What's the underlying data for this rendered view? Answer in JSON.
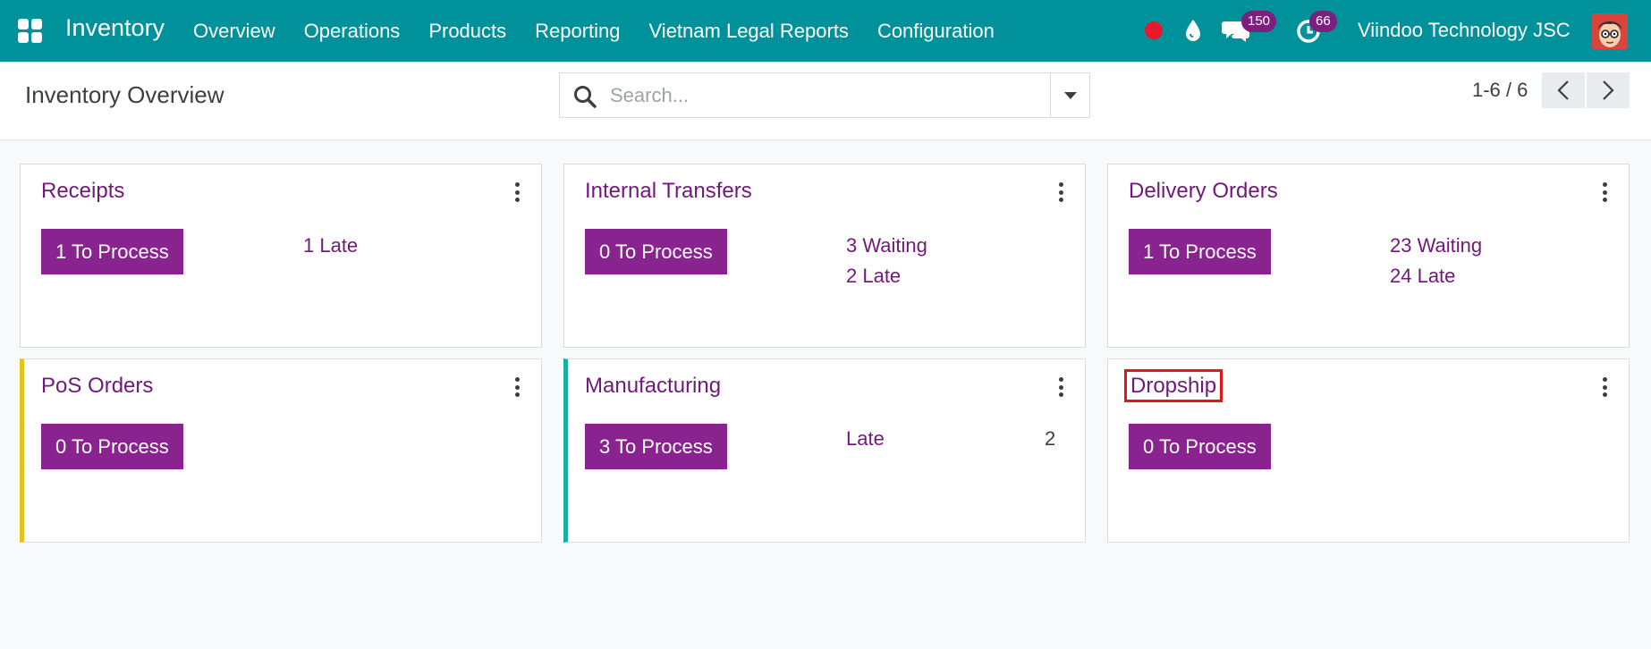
{
  "navbar": {
    "app_name": "Inventory",
    "menu": [
      "Overview",
      "Operations",
      "Products",
      "Reporting",
      "Vietnam Legal Reports",
      "Configuration"
    ],
    "chat_count": "150",
    "activity_count": "66",
    "company": "Viindoo Technology JSC",
    "colors": {
      "background": "#00919b",
      "badge": "#7c1f7f",
      "record": "#e8182d"
    }
  },
  "control_panel": {
    "title": "Inventory Overview",
    "search_placeholder": "Search...",
    "pager": "1-6 / 6"
  },
  "cards": [
    {
      "title": "Receipts",
      "button": "1 To Process",
      "links": [
        "1 Late"
      ]
    },
    {
      "title": "Internal Transfers",
      "button": "0 To Process",
      "links": [
        "3 Waiting",
        "2 Late"
      ]
    },
    {
      "title": "Delivery Orders",
      "button": "1 To Process",
      "links": [
        "23 Waiting",
        "24 Late"
      ]
    },
    {
      "title": "PoS Orders",
      "button": "0 To Process",
      "links": []
    },
    {
      "title": "Manufacturing",
      "button": "3 To Process",
      "links": [
        "Late"
      ],
      "late_count": "2"
    },
    {
      "title": "Dropship",
      "button": "0 To Process",
      "links": []
    }
  ],
  "colors": {
    "primary": "#892390",
    "title": "#71197a",
    "pos_border": "#e2c31a",
    "mrp_border": "#1aaea5",
    "highlight": "#e3161c"
  }
}
